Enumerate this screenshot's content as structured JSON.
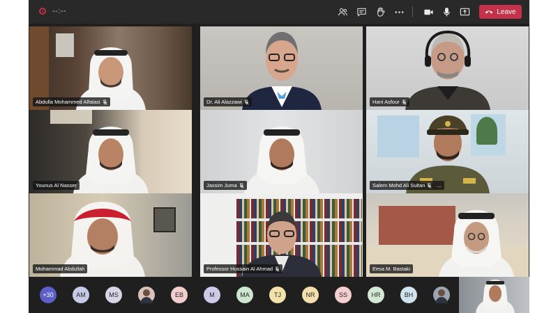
{
  "meeting": {
    "timer": "--:--",
    "leave_label": "Leave",
    "accent_color": "#c4314b"
  },
  "toolbar": [
    {
      "name": "participants-icon"
    },
    {
      "name": "chat-icon"
    },
    {
      "name": "raise-hand-icon"
    },
    {
      "name": "more-actions-icon"
    },
    {
      "name": "camera-icon"
    },
    {
      "name": "microphone-icon"
    },
    {
      "name": "share-screen-icon"
    }
  ],
  "participants": [
    {
      "name": "Abdulla Mohammed Alfalasi",
      "muted": true
    },
    {
      "name": "Dr. Ali Alazzawi",
      "muted": true
    },
    {
      "name": "Hani Asfour",
      "muted": true
    },
    {
      "name": "Younus Al Nasser",
      "muted": false
    },
    {
      "name": "Jassim Juma",
      "muted": true
    },
    {
      "name": "Salem Mohd Ali Sultan",
      "muted": true,
      "more": "..."
    },
    {
      "name": "Mohammad Abdullah",
      "muted": false
    },
    {
      "name": "Professor Hussain Al Ahmad",
      "muted": true
    },
    {
      "name": "Eesa M. Bastaki",
      "muted": false
    }
  ],
  "roster": {
    "overflow_count": "+30",
    "avatars": [
      {
        "initials": "AM",
        "color": "#c5cbe6"
      },
      {
        "initials": "MS",
        "color": "#d9d3e6"
      },
      {
        "initials": "",
        "photo": true,
        "color": "#d8c3b8"
      },
      {
        "initials": "EB",
        "color": "#f2cfcf"
      },
      {
        "initials": "M",
        "color": "#cfc8e6"
      },
      {
        "initials": "MA",
        "color": "#cde6cf"
      },
      {
        "initials": "TJ",
        "color": "#f3e2a9"
      },
      {
        "initials": "NR",
        "color": "#f6dfae"
      },
      {
        "initials": "SS",
        "color": "#f4cfcf"
      },
      {
        "initials": "HR",
        "color": "#d3e9d4"
      },
      {
        "initials": "BH",
        "color": "#cfe2ee"
      },
      {
        "initials": "",
        "photo": true,
        "color": "#9aa7b3"
      }
    ]
  }
}
